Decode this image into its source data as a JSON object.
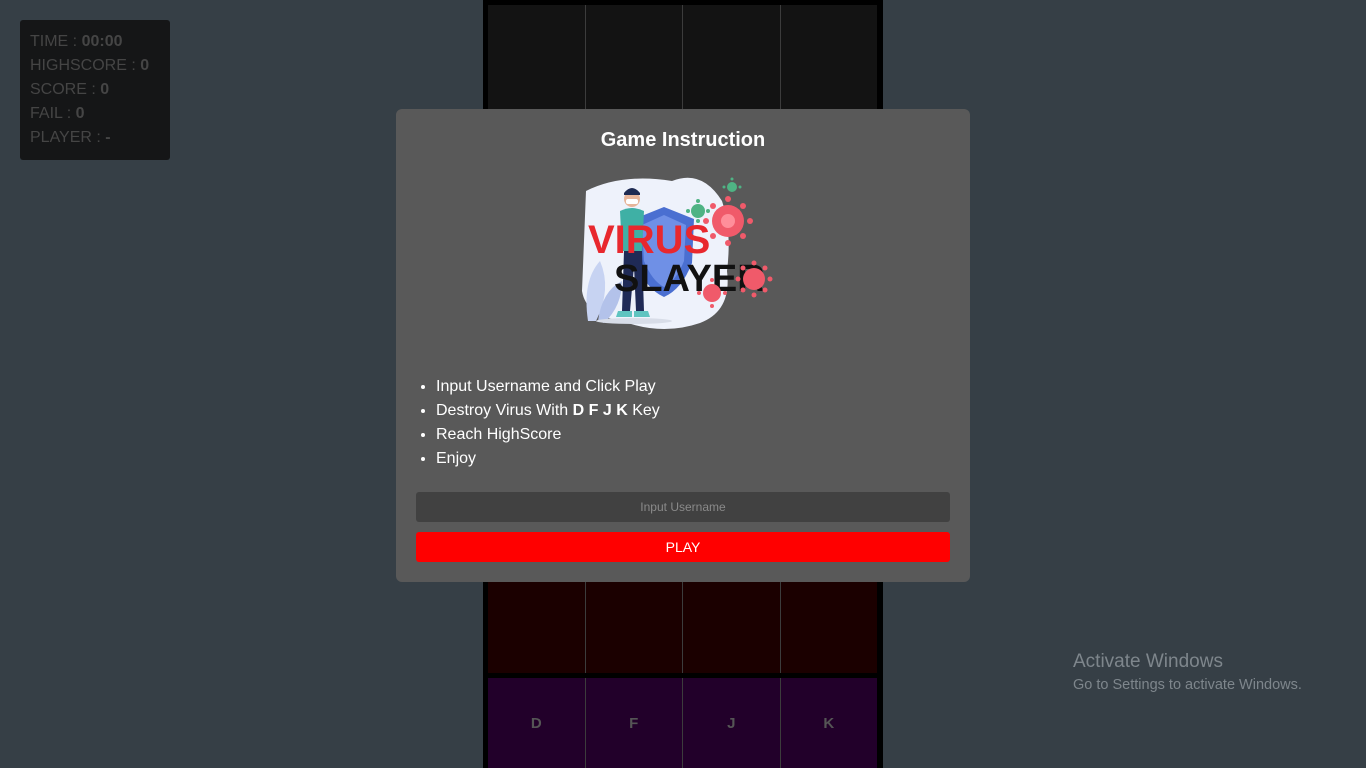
{
  "stats": {
    "time_label": "TIME : ",
    "time_value": "00:00",
    "highscore_label": "HIGHSCORE : ",
    "highscore_value": "0",
    "score_label": "SCORE : ",
    "score_value": "0",
    "fail_label": "FAIL : ",
    "fail_value": "0",
    "player_label": "PLAYER : ",
    "player_value": "-"
  },
  "board": {
    "keys": [
      "D",
      "F",
      "J",
      "K"
    ]
  },
  "modal": {
    "title": "Game Instruction",
    "logo_icon": "virus-slayer-logo",
    "instructions": {
      "item1": "Input Username and Click Play",
      "item2_prefix": "Destroy Virus With ",
      "item2_keys": "D F J K",
      "item2_suffix": " Key",
      "item3": "Reach HighScore",
      "item4": "Enjoy"
    },
    "username_placeholder": "Input Username",
    "play_label": "PLAY"
  },
  "activation": {
    "title": "Activate Windows",
    "subtitle": "Go to Settings to activate Windows."
  },
  "colors": {
    "background": "#363f46",
    "modal": "#595959",
    "play_button": "#ff0000",
    "key_zone": "#22002a"
  }
}
